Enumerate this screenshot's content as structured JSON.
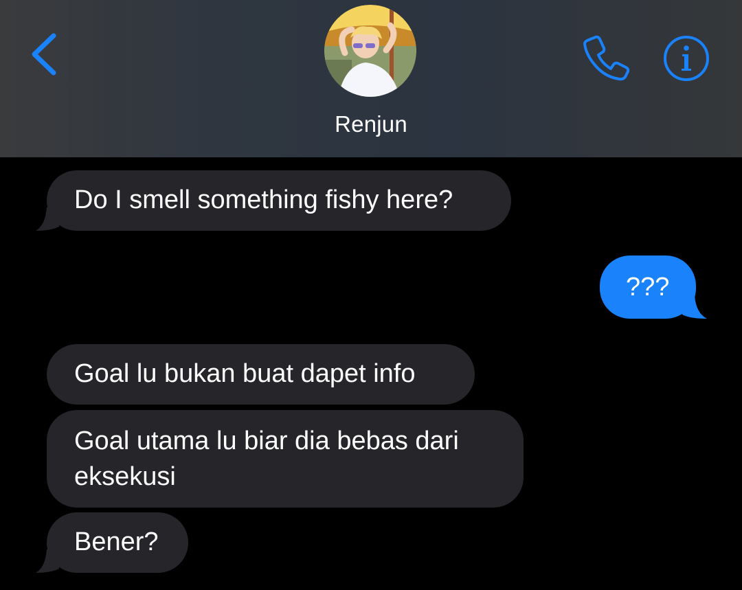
{
  "header": {
    "contact_name": "Renjun",
    "accent_color": "#1a82fb",
    "icons": {
      "back": "chevron-left-icon",
      "call": "phone-icon",
      "info": "info-icon"
    }
  },
  "messages": [
    {
      "from": "them",
      "text": "Do I smell something fishy here?"
    },
    {
      "from": "me",
      "text": "???"
    },
    {
      "from": "them",
      "text": "Goal lu bukan buat dapet info"
    },
    {
      "from": "them",
      "text": "Goal utama lu biar dia bebas dari eksekusi"
    },
    {
      "from": "them",
      "text": "Bener?"
    }
  ]
}
